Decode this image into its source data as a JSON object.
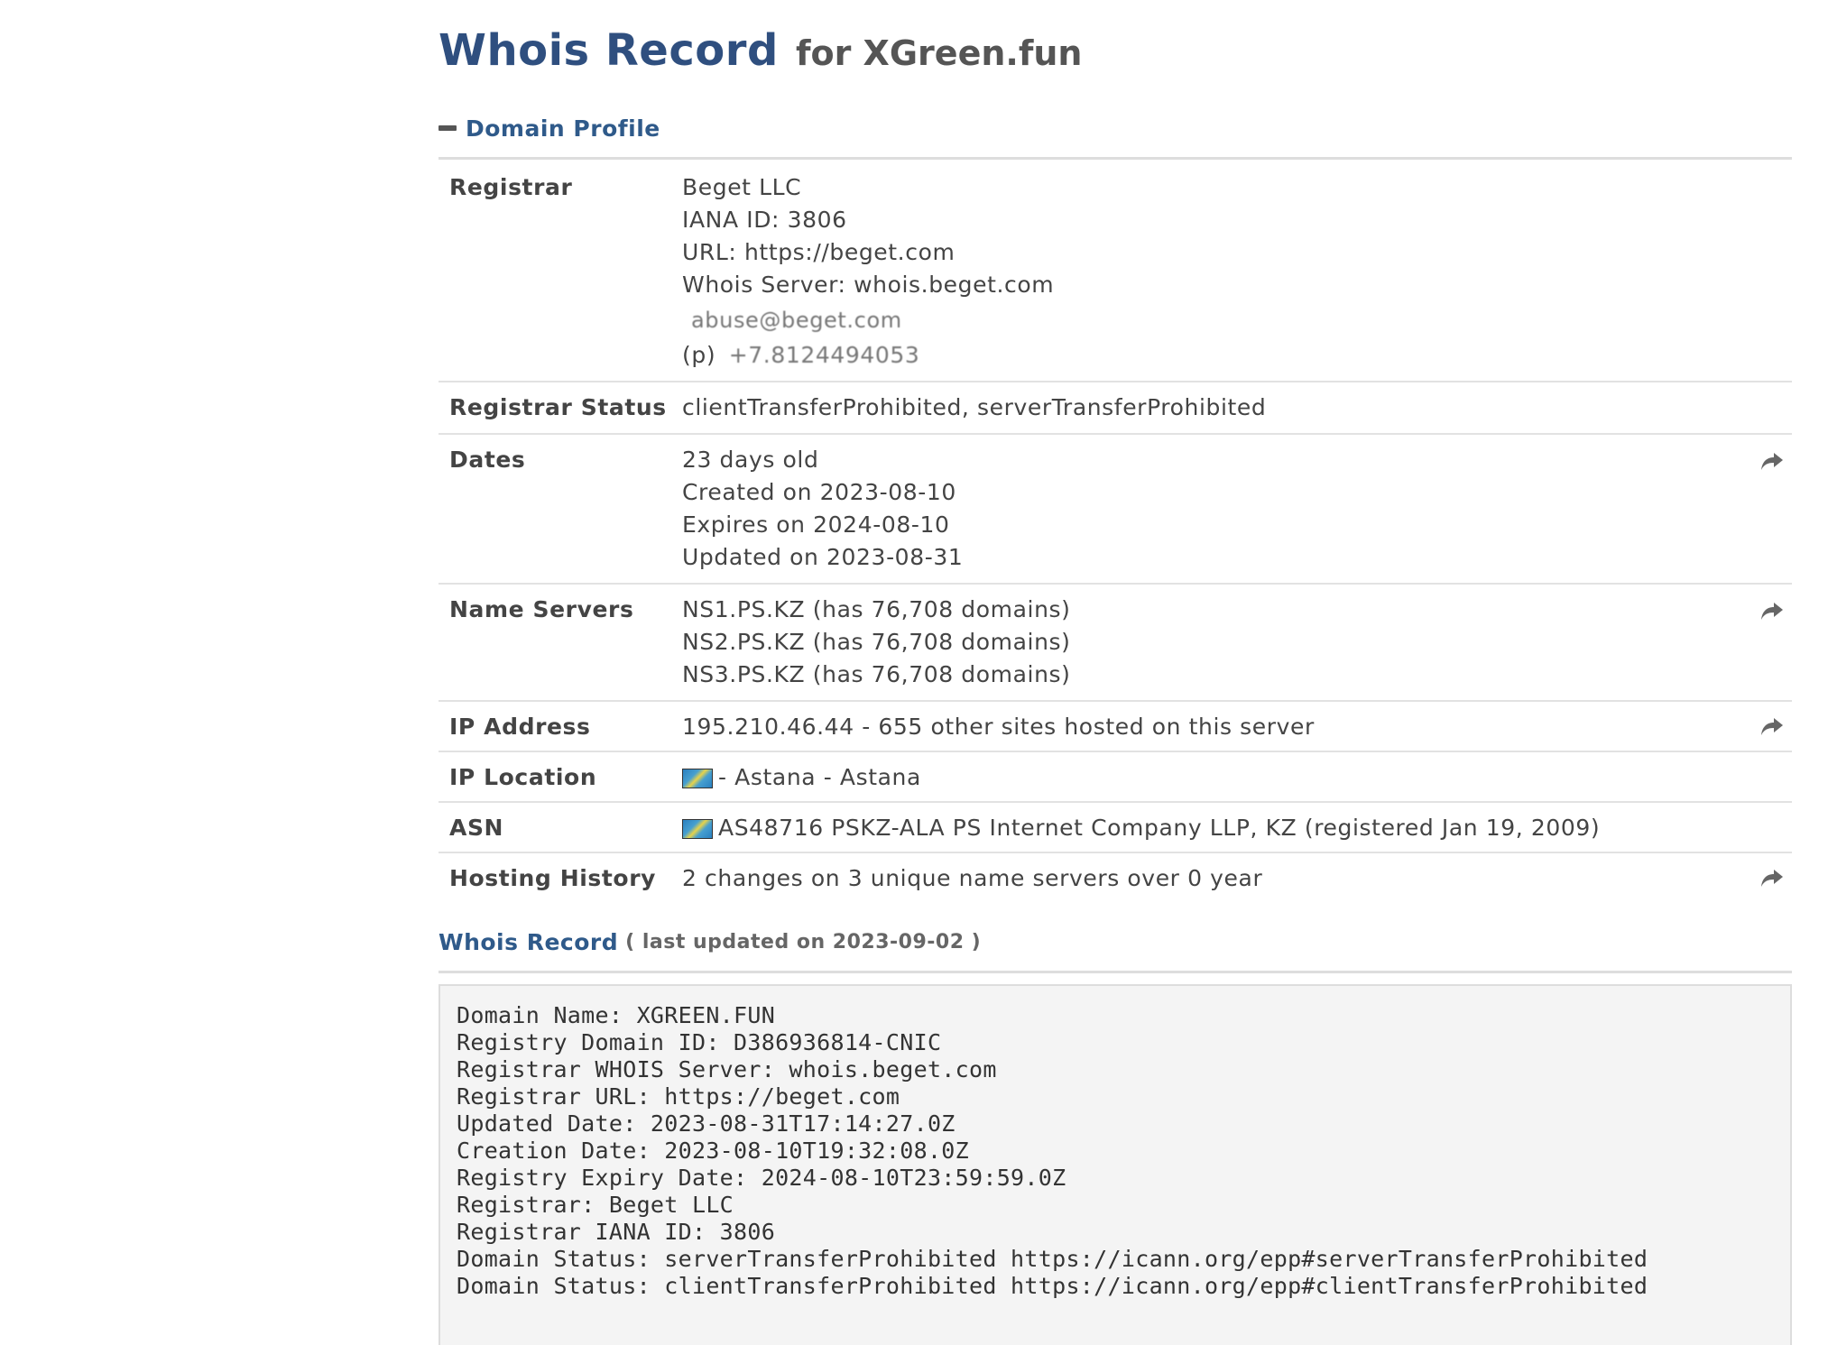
{
  "header": {
    "title_main": "Whois Record",
    "title_sub": "for XGreen.fun"
  },
  "profile": {
    "section_label": "Domain Profile",
    "registrar": {
      "label": "Registrar",
      "lines": [
        "Beget LLC",
        "IANA ID: 3806",
        "URL: https://beget.com",
        "Whois Server: whois.beget.com"
      ],
      "email": "abuse@beget.com",
      "phone_prefix": "(p)",
      "phone": "+7.8124494053"
    },
    "registrar_status": {
      "label": "Registrar Status",
      "value": "clientTransferProhibited, serverTransferProhibited"
    },
    "dates": {
      "label": "Dates",
      "lines": [
        "23 days old",
        "Created on 2023-08-10",
        "Expires on 2024-08-10",
        "Updated on 2023-08-31"
      ]
    },
    "name_servers": {
      "label": "Name Servers",
      "lines": [
        "NS1.PS.KZ (has 76,708 domains)",
        "NS2.PS.KZ (has 76,708 domains)",
        "NS3.PS.KZ (has 76,708 domains)"
      ]
    },
    "ip_address": {
      "label": "IP Address",
      "value": "195.210.46.44 - 655 other sites hosted on this server"
    },
    "ip_location": {
      "label": "IP Location",
      "value": "- Astana - Astana"
    },
    "asn": {
      "label": "ASN",
      "value": "AS48716 PSKZ-ALA PS Internet Company LLP, KZ (registered Jan 19, 2009)"
    },
    "hosting_history": {
      "label": "Hosting History",
      "value": "2 changes on 3 unique name servers over 0 year"
    }
  },
  "record": {
    "label": "Whois Record",
    "updated": "( last updated on 2023-09-02 )",
    "lines": [
      "Domain Name: XGREEN.FUN",
      "Registry Domain ID: D386936814-CNIC",
      "Registrar WHOIS Server: whois.beget.com",
      "Registrar URL: https://beget.com",
      "Updated Date: 2023-08-31T17:14:27.0Z",
      "Creation Date: 2023-08-10T19:32:08.0Z",
      "Registry Expiry Date: 2024-08-10T23:59:59.0Z",
      "Registrar: Beget LLC",
      "Registrar IANA ID: 3806",
      "Domain Status: serverTransferProhibited https://icann.org/epp#serverTransferProhibited",
      "Domain Status: clientTransferProhibited https://icann.org/epp#clientTransferProhibited"
    ]
  },
  "icons": {
    "share": "share-arrow-icon",
    "flag": "kazakhstan-flag-icon",
    "collapse": "minus-icon"
  }
}
